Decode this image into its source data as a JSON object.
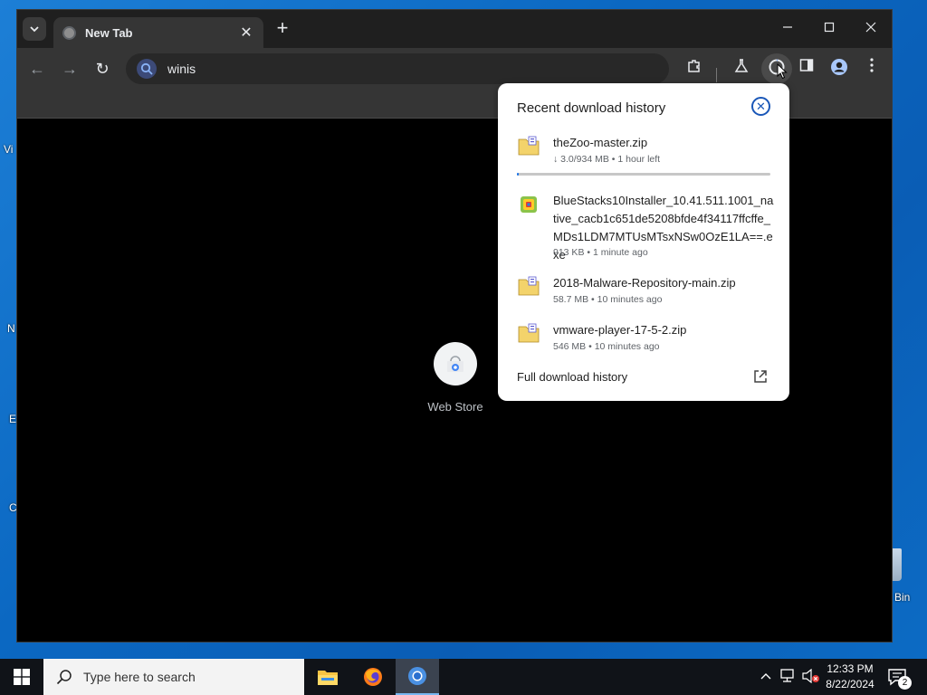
{
  "browser": {
    "tab": {
      "title": "New Tab",
      "close_glyph": "✕"
    },
    "new_tab_glyph": "+",
    "window_controls": {
      "minimize": "—",
      "maximize": "☐",
      "close": "✕"
    },
    "omnibox": {
      "value": "winis",
      "icon": "search-icon"
    },
    "nav": {
      "back": "←",
      "forward": "→",
      "reload": "↻"
    }
  },
  "new_tab_page": {
    "shortcut": {
      "label": "Web Store"
    }
  },
  "downloads_panel": {
    "title": "Recent download history",
    "close_label": "✕",
    "items": [
      {
        "name": "theZoo-master.zip",
        "meta": "↓ 3.0/934 MB • 1 hour left",
        "icon": "zip-file-icon",
        "progress": 0.0032
      },
      {
        "name": "BlueStacks10Installer_10.41.511.1001_native_cacb1c651de5208bfde4f34117ffcffe_MDs1LDM7MTUsMTsxNSw0OzE1LA==.exe",
        "meta": "913 KB • 1 minute ago",
        "icon": "bluestacks-icon"
      },
      {
        "name": "2018-Malware-Repository-main.zip",
        "meta": "58.7 MB • 10 minutes ago",
        "icon": "zip-file-icon"
      },
      {
        "name": "vmware-player-17-5-2.zip",
        "meta": "546 MB • 10 minutes ago",
        "icon": "zip-file-icon"
      }
    ],
    "full_history_label": "Full download history"
  },
  "desktop": {
    "recycle_bin_label": "Bin",
    "fragments": [
      "Vi",
      "N",
      "E",
      "C"
    ]
  },
  "taskbar": {
    "search_placeholder": "Type here to search",
    "clock_time": "12:33 PM",
    "clock_date": "8/22/2024",
    "notification_count": "2"
  }
}
